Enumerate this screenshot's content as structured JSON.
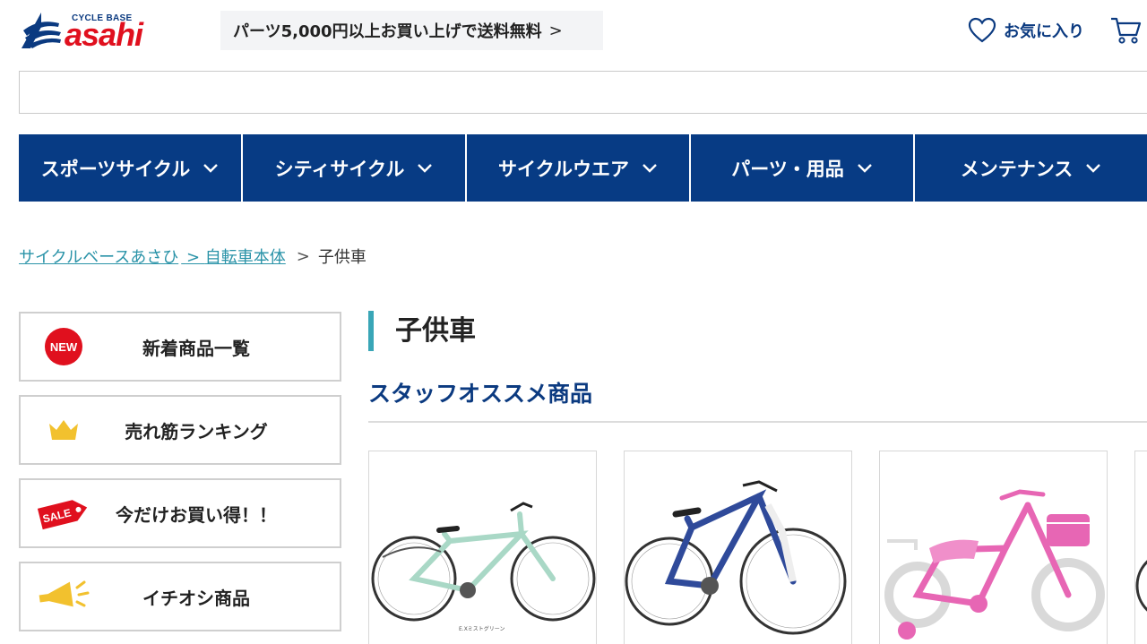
{
  "header": {
    "logo_small": "CYCLE BASE",
    "logo_big": "asahi",
    "promo_text": "パーツ5,000円以上お買い上げで送料無料",
    "promo_arrow": ">",
    "favorites_label": "お気に入り"
  },
  "search": {
    "value": "",
    "placeholder": ""
  },
  "nav": {
    "items": [
      {
        "label": "スポーツサイクル"
      },
      {
        "label": "シティサイクル"
      },
      {
        "label": "サイクルウエア"
      },
      {
        "label": "パーツ・用品"
      },
      {
        "label": "メンテナンス"
      }
    ]
  },
  "breadcrumb": {
    "home": "サイクルベースあさひ",
    "sep": ">",
    "parent": "自転車本体",
    "current": "子供車"
  },
  "sidebar": {
    "items": [
      {
        "label": "新着商品一覧",
        "icon": "new-badge-icon",
        "badge": "NEW"
      },
      {
        "label": "売れ筋ランキング",
        "icon": "crown-icon"
      },
      {
        "label": "今だけお買い得！！",
        "icon": "sale-tag-icon",
        "badge": "SALE"
      },
      {
        "label": "イチオシ商品",
        "icon": "megaphone-icon"
      }
    ]
  },
  "main": {
    "page_title": "子供車",
    "section_title": "スタッフオススメ商品",
    "products": [
      {
        "color_name": "E.Xミストグリーン",
        "frame_color": "#a9d8c6"
      },
      {
        "frame_color": "#2f4a9a"
      },
      {
        "frame_color": "#e766b4"
      }
    ]
  },
  "colors": {
    "nav_bg": "#073b84",
    "brand_blue": "#0b3a80",
    "brand_red": "#e0101e",
    "accent_teal": "#39a6b7",
    "link": "#2a93a8"
  }
}
